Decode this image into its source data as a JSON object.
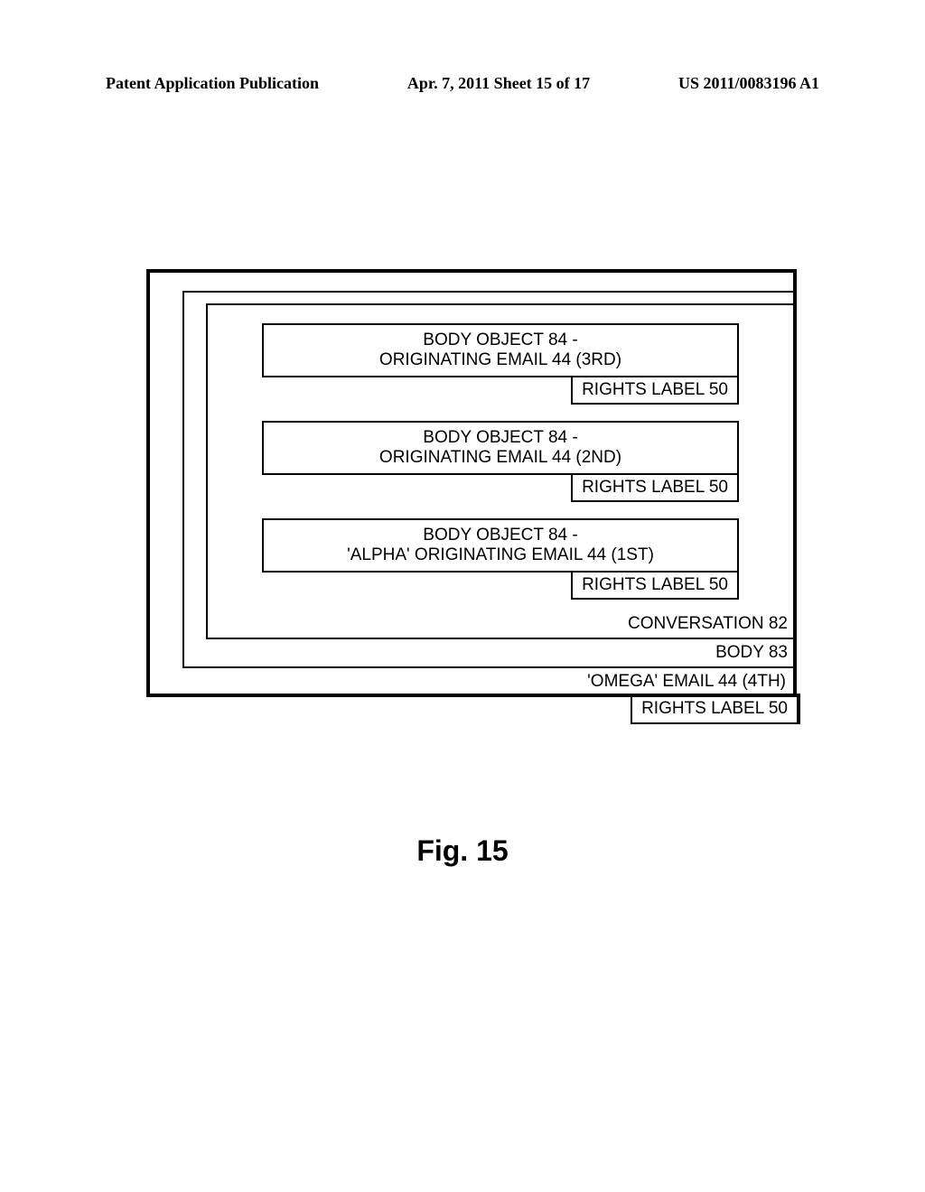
{
  "header": {
    "left": "Patent Application Publication",
    "center": "Apr. 7, 2011  Sheet 15 of 17",
    "right": "US 2011/0083196 A1"
  },
  "diagram": {
    "body_objects": [
      {
        "line1": "BODY OBJECT 84 -",
        "line2": "ORIGINATING EMAIL 44 (3RD)",
        "rights": "RIGHTS LABEL 50"
      },
      {
        "line1": "BODY OBJECT 84 -",
        "line2": "ORIGINATING EMAIL 44 (2ND)",
        "rights": "RIGHTS LABEL 50"
      },
      {
        "line1": "BODY OBJECT 84 -",
        "line2": "'ALPHA' ORIGINATING EMAIL 44 (1ST)",
        "rights": "RIGHTS LABEL 50"
      }
    ],
    "conversation_label": "CONVERSATION 82",
    "body_label": "BODY 83",
    "omega_label": "'OMEGA' EMAIL 44 (4TH)",
    "outer_rights": "RIGHTS LABEL 50"
  },
  "caption": "Fig. 15"
}
